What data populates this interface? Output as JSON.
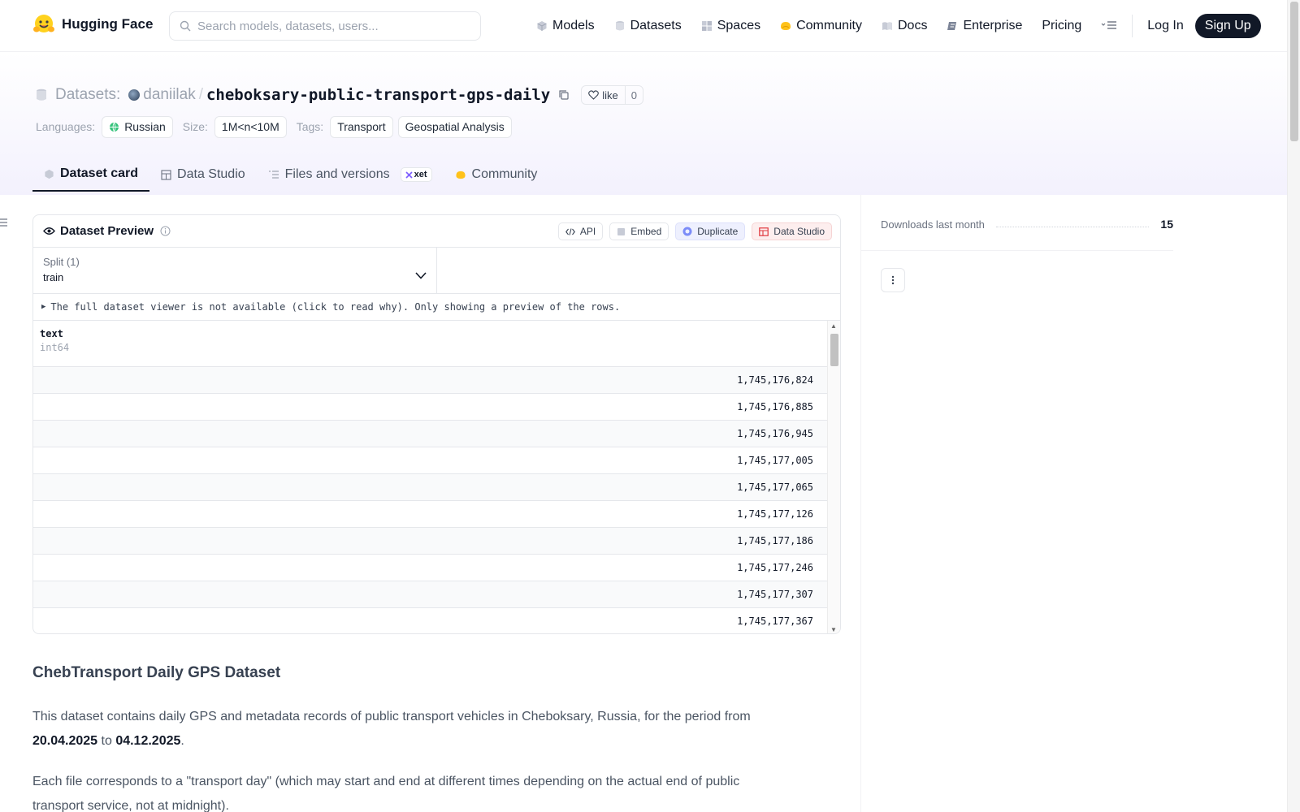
{
  "brand": {
    "name": "Hugging Face"
  },
  "search": {
    "placeholder": "Search models, datasets, users..."
  },
  "nav": {
    "items": [
      {
        "label": "Models",
        "icon": "model-cube-icon"
      },
      {
        "label": "Datasets",
        "icon": "database-icon"
      },
      {
        "label": "Spaces",
        "icon": "spaces-grid-icon"
      },
      {
        "label": "Community",
        "icon": "hugging-hands-icon"
      },
      {
        "label": "Docs",
        "icon": "book-icon"
      },
      {
        "label": "Enterprise",
        "icon": "enterprise-icon"
      },
      {
        "label": "Pricing",
        "icon": ""
      }
    ],
    "login": "Log In",
    "signup": "Sign Up"
  },
  "repo": {
    "kind_label": "Datasets:",
    "owner": "daniilak",
    "separator": "/",
    "name": "cheboksary-public-transport-gps-daily",
    "like_label": "like",
    "like_count": "0"
  },
  "meta": {
    "languages_label": "Languages:",
    "language": "Russian",
    "size_label": "Size:",
    "size": "1M<n<10M",
    "tags_label": "Tags:",
    "tags": [
      "Transport",
      "Geospatial Analysis"
    ]
  },
  "tabs": [
    {
      "label": "Dataset card",
      "active": true
    },
    {
      "label": "Data Studio",
      "active": false
    },
    {
      "label": "Files and versions",
      "active": false,
      "badge": "xet"
    },
    {
      "label": "Community",
      "active": false
    }
  ],
  "preview": {
    "title": "Dataset Preview",
    "actions": {
      "api": "API",
      "embed": "Embed",
      "duplicate": "Duplicate",
      "studio": "Data Studio"
    },
    "split_label": "Split (1)",
    "split_value": "train",
    "notice": "The full dataset viewer is not available (click to read why). Only showing a preview of the rows.",
    "column": {
      "name": "text",
      "type": "int64"
    },
    "rows": [
      "1,745,176,824",
      "1,745,176,885",
      "1,745,176,945",
      "1,745,177,005",
      "1,745,177,065",
      "1,745,177,126",
      "1,745,177,186",
      "1,745,177,246",
      "1,745,177,307",
      "1,745,177,367"
    ]
  },
  "card": {
    "title": "ChebTransport Daily GPS Dataset",
    "p1_before": "This dataset contains daily GPS and metadata records of public transport vehicles in Cheboksary, Russia, for the period from ",
    "p1_date_from": "20.04.2025",
    "p1_to": " to ",
    "p1_date_to": "04.12.2025",
    "p1_after": ".",
    "p2": "Each file corresponds to a \"transport day\" (which may start and end at different times depending on the actual end of public transport service, not at midnight)."
  },
  "sidebar": {
    "downloads_label": "Downloads last month",
    "downloads_value": "15"
  },
  "colors": {
    "accent_dark": "#111827",
    "muted": "#9ca3af",
    "header_tint": "#f3f1fd"
  }
}
